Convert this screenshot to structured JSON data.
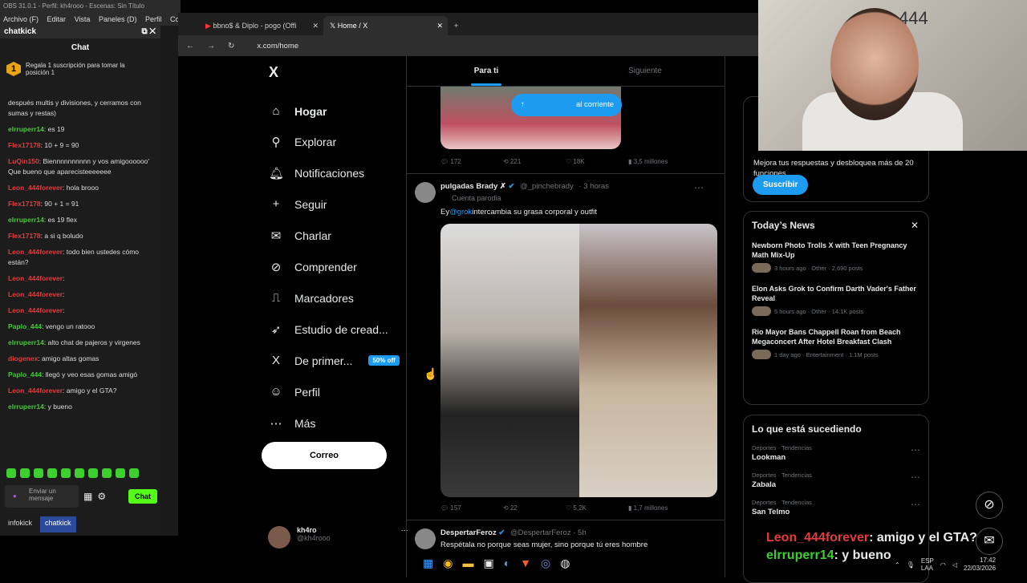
{
  "obs": {
    "title": "OBS 31.0.1 - Perfil: kh4rooo - Escenas: Sin Título",
    "menu": [
      "Archivo (F)",
      "Editar",
      "Vista",
      "Paneles (D)",
      "Perfil",
      "Col"
    ],
    "dock_title": "chatkick",
    "chat_title": "Chat",
    "promo_badge": "1",
    "promo_text": "Regala 1 suscripción para tomar la posición 1",
    "messages": [
      {
        "user": "",
        "text": "después multis y divisiones, y cerramos con sumas y restas)",
        "color": "#dddddd"
      },
      {
        "user": "elrruperr14",
        "text": ": es 19",
        "color": "#3ccf2e"
      },
      {
        "user": "Flex17178",
        "text": ": 10 + 9 = 90",
        "color": "#e23c3c"
      },
      {
        "user": "LuQin150",
        "text": ": Biennnnnnnnnn y vos amigoooooo' Que bueno que aparecisteeeeeee",
        "color": "#e23c3c"
      },
      {
        "user": "Leon_444forever",
        "text": ": hola brooo",
        "color": "#e23c3c"
      },
      {
        "user": "Flex17178",
        "text": ": 90 + 1 = 91",
        "color": "#e23c3c"
      },
      {
        "user": "elrruperr14",
        "text": ": es 19 flex",
        "color": "#3ccf2e"
      },
      {
        "user": "Flex17178",
        "text": ": a si q boludo",
        "color": "#e23c3c"
      },
      {
        "user": "Leon_444forever",
        "text": ": todo bien ustedes cómo están?",
        "color": "#e23c3c"
      },
      {
        "user": "Leon_444forever",
        "text": ":",
        "color": "#e23c3c"
      },
      {
        "user": "Leon_444forever",
        "text": ":",
        "color": "#e23c3c"
      },
      {
        "user": "Leon_444forever",
        "text": ":",
        "color": "#e23c3c"
      },
      {
        "user": "Paplo_444",
        "text": ": vengo un ratooo",
        "color": "#3ccf2e"
      },
      {
        "user": "elrruperr14",
        "text": ": alto chat de pajeros y virgenes",
        "color": "#3ccf2e"
      },
      {
        "user": "diogenex",
        "text": ": amigo altas gomas",
        "color": "#e23c3c"
      },
      {
        "user": "Paplo_444",
        "text": ": llegó y veo esas gomas amigó",
        "color": "#3ccf2e"
      },
      {
        "user": "Leon_444forever",
        "text": ": amigo y el GTA?",
        "color": "#e23c3c"
      },
      {
        "user": "elrruperr14",
        "text": ": y bueno",
        "color": "#3ccf2e"
      }
    ],
    "input_placeholder": "Enviar un mensaje",
    "send_label": "Chat",
    "dock_tabs": [
      "infokick",
      "chatkick"
    ]
  },
  "browser": {
    "tabs": [
      {
        "title": "bbno$ & Diplo - pogo (Offi",
        "active": false
      },
      {
        "title": "Home / X",
        "active": true
      }
    ],
    "url": "x.com/home"
  },
  "x": {
    "logo": "X",
    "nav": [
      {
        "icon": "home-icon",
        "glyph": "⌂",
        "label": "Hogar",
        "bold": true
      },
      {
        "icon": "search-icon",
        "glyph": "⚲",
        "label": "Explorar"
      },
      {
        "icon": "bell-icon",
        "glyph": "🔔︎",
        "label": "Notificaciones"
      },
      {
        "icon": "follow-icon",
        "glyph": "+",
        "label": "Seguir"
      },
      {
        "icon": "mail-icon",
        "glyph": "✉",
        "label": "Charlar"
      },
      {
        "icon": "grok-icon",
        "glyph": "⊘",
        "label": "Comprender"
      },
      {
        "icon": "bookmark-icon",
        "glyph": "⎍",
        "label": "Marcadores"
      },
      {
        "icon": "rocket-icon",
        "glyph": "➶",
        "label": "Estudio de cread..."
      },
      {
        "icon": "x-premium-icon",
        "glyph": "X",
        "label": "De primer..."
      },
      {
        "icon": "profile-icon",
        "glyph": "☺",
        "label": "Perfil"
      },
      {
        "icon": "more-icon",
        "glyph": "⋯",
        "label": "Más"
      }
    ],
    "premium_badge": "50% off",
    "post_button": "Correo",
    "profile_name": "kh4ro",
    "profile_handle": "@kh4rooo",
    "tabs": [
      "Para ti",
      "Siguiente"
    ],
    "new_posts_pill": "al corriente",
    "tweet1_actions": [
      "172",
      "221",
      "18K",
      "3,5 millones"
    ],
    "tweet2": {
      "name": "pulgadas Brady ✗",
      "handle": "@_pinchebrady",
      "time": "· 3 horas",
      "sub": "Cuenta parodia",
      "text_pre": "Ey",
      "mention": "@grok",
      "text_post": "intercambia su grasa corporal y outfit",
      "actions": [
        "157",
        "22",
        "5,2K",
        "1,7 millones"
      ]
    },
    "tweet3": {
      "name": "DespertarFeroz",
      "handle": "@DespertarFeroz · 5h",
      "text": "Respétala no porque seas mujer, sino porque tú eres hombre"
    },
    "premium_card": {
      "partial_text": "Mejora tus respuestas y desbloquea más de 20 funciones.",
      "button": "Suscribir"
    },
    "news": {
      "title": "Today’s News",
      "items": [
        {
          "title": "Newborn Photo Trolls X with Teen Pregnancy Math Mix-Up",
          "meta": "3 hours ago · Other · 2,690 posts"
        },
        {
          "title": "Elon Asks Grok to Confirm Darth Vader's Father Reveal",
          "meta": "5 hours ago · Other · 14.1K posts"
        },
        {
          "title": "Rio Mayor Bans Chappell Roan from Beach Megaconcert After Hotel Breakfast Clash",
          "meta": "1 day ago · Entertainment · 1.1M posts"
        }
      ]
    },
    "trends": {
      "title": "Lo que está sucediendo",
      "items": [
        {
          "category": "Deportes · Tendencias",
          "name": "Lookman"
        },
        {
          "category": "Deportes · Tendencias",
          "name": "Zabala"
        },
        {
          "category": "Deportes · Tendencias",
          "name": "San Telmo"
        }
      ]
    }
  },
  "overlay": {
    "line1_user": "Leon_444forever",
    "line1_text": ": amigo y el GTA?",
    "line2_user": "elrruperr14",
    "line2_text": ": y bueno"
  },
  "webcam_wall_text": "444",
  "taskbar": {
    "lang": "ESP",
    "lang2": "LAA",
    "time": "17:42",
    "date": "22/03/2026"
  }
}
